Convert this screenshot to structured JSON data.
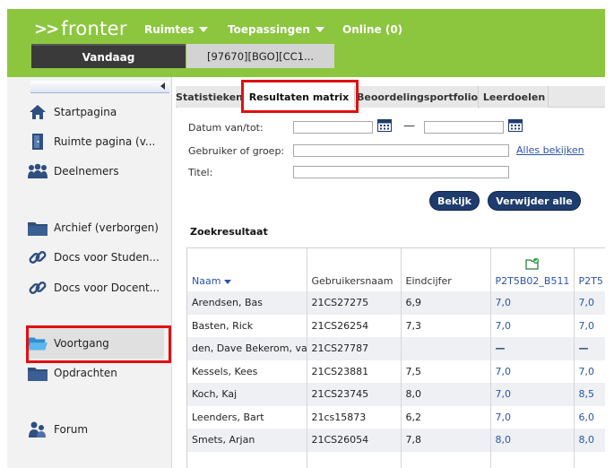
{
  "app": {
    "logo": "fronter"
  },
  "topnav": {
    "spaces": "Ruimtes",
    "tools": "Toepassingen",
    "online": "Online (0)"
  },
  "window_tabs": {
    "today": "Vandaag",
    "course": "[97670][BGO][CC1..."
  },
  "sidebar": {
    "items": [
      {
        "label": "Startpagina",
        "icon": "home-icon"
      },
      {
        "label": "Ruimte pagina (v...",
        "icon": "room-door-icon"
      },
      {
        "label": "Deelnemers",
        "icon": "participants-icon"
      },
      {
        "label": "Archief (verborgen)",
        "icon": "folder-icon"
      },
      {
        "label": "Docs voor Studen...",
        "icon": "link-chain-icon"
      },
      {
        "label": "Docs voor Docent...",
        "icon": "link-chain-icon"
      },
      {
        "label": "Voortgang",
        "icon": "open-folder-icon"
      },
      {
        "label": "Opdrachten",
        "icon": "folder-icon"
      },
      {
        "label": "Forum",
        "icon": "forum-users-icon"
      }
    ]
  },
  "content_tabs": [
    {
      "label": "Statistieken"
    },
    {
      "label": "Resultaten matrix"
    },
    {
      "label": "Beoordelingsportfolio"
    },
    {
      "label": "Leerdoelen"
    }
  ],
  "form": {
    "date_label": "Datum van/tot:",
    "user_label": "Gebruiker of groep:",
    "title_label": "Titel:",
    "see_all_link": "Alles bekijken",
    "date_from_value": "",
    "date_to_value": "",
    "user_value": "",
    "title_value": ""
  },
  "buttons": {
    "view": "Bekijk",
    "delete_all": "Verwijder alle"
  },
  "results": {
    "title": "Zoekresultaat",
    "columns": [
      "Naam",
      "Gebruikersnaam",
      "Eindcijfer",
      "P2T5B02_B511",
      "P2T5"
    ],
    "rows": [
      [
        "Arendsen, Bas",
        "21CS27275",
        "6,9",
        "7,0",
        "7,0"
      ],
      [
        "Basten, Rick",
        "21CS26254",
        "7,3",
        "7,0",
        "7,0"
      ],
      [
        "den, Dave Bekerom, va",
        "21CS27787",
        "",
        "—",
        "—"
      ],
      [
        "Kessels, Kees",
        "21CS23881",
        "7,5",
        "7,0",
        "7,0"
      ],
      [
        "Koch, Kaj",
        "21CS23745",
        "8,0",
        "7,0",
        "8,5"
      ],
      [
        "Leenders, Bart",
        "21cs15873",
        "6,2",
        "7,0",
        "6,0"
      ],
      [
        "Smets, Arjan",
        "21CS26054",
        "7,8",
        "8,0",
        "8,0"
      ],
      [
        "",
        "",
        "",
        "",
        ""
      ]
    ]
  }
}
